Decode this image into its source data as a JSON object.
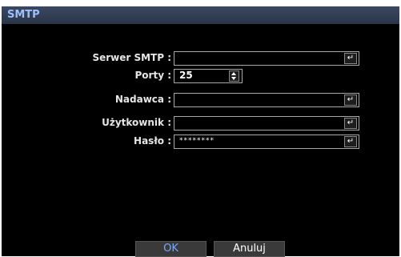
{
  "dialog": {
    "title": "SMTP",
    "fields": {
      "server": {
        "label": "Serwer SMTP :",
        "value": ""
      },
      "port": {
        "label": "Porty :",
        "value": "25"
      },
      "sender": {
        "label": "Nadawca :",
        "value": ""
      },
      "user": {
        "label": "Użytkownik :",
        "value": ""
      },
      "password": {
        "label": "Hasło :",
        "value": "********"
      }
    },
    "buttons": {
      "ok": "OK",
      "cancel": "Anuluj"
    },
    "icons": {
      "enter": "↵"
    },
    "colors": {
      "title": "#9fbfff",
      "ok_text": "#7aa7ff",
      "field_border": "#a8a8a8"
    }
  }
}
